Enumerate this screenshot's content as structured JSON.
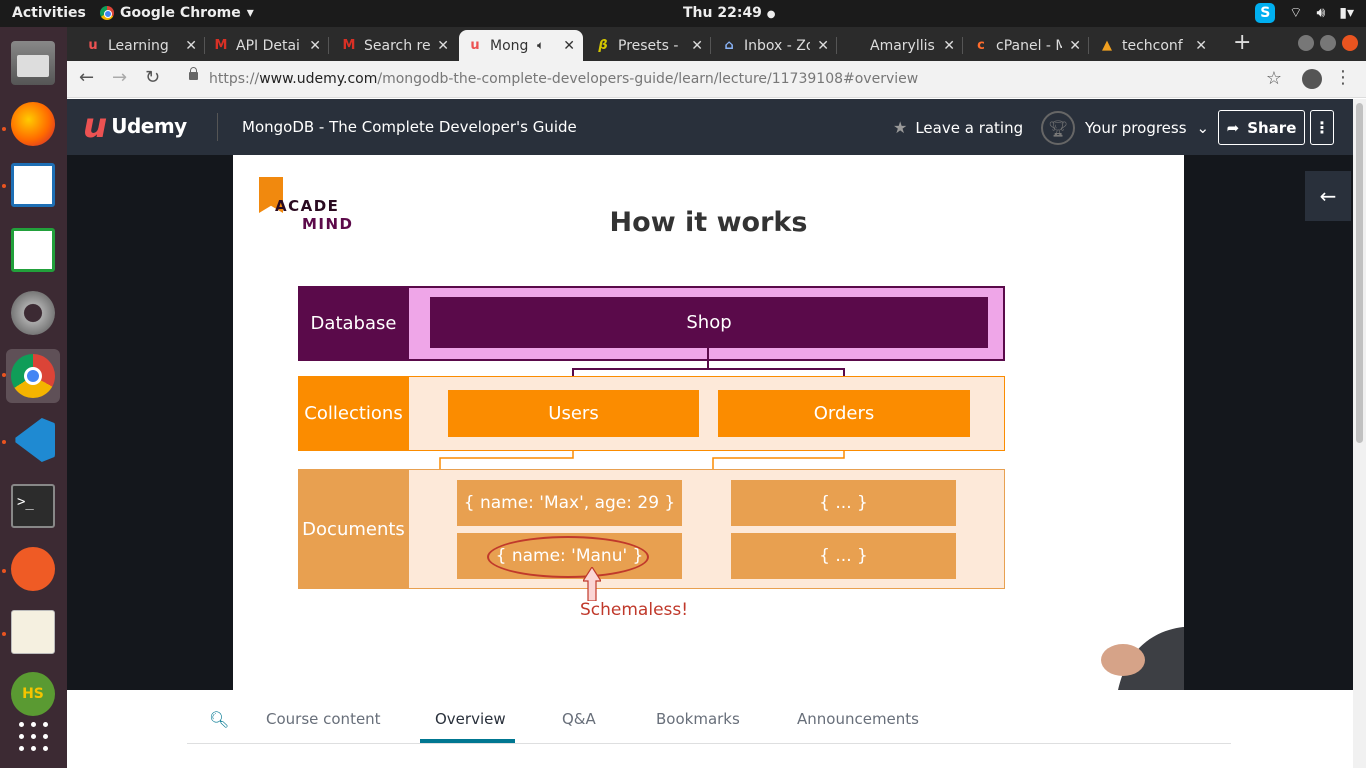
{
  "system_bar": {
    "activities": "Activities",
    "app_name": "Google Chrome",
    "clock": "Thu 22:49"
  },
  "dock": {
    "items": [
      "files-icon",
      "firefox-icon",
      "writer-icon",
      "calc-icon",
      "settings-icon",
      "chrome-icon",
      "vscode-icon",
      "terminal-icon",
      "postman-icon",
      "text-editor-icon",
      "hs-icon",
      "apps-grid-icon"
    ]
  },
  "tabs": [
    {
      "label": "Learning",
      "icon": "udemy-icon"
    },
    {
      "label": "API Detai",
      "icon": "gmail-icon"
    },
    {
      "label": "Search re",
      "icon": "gmail-icon"
    },
    {
      "label": "Mong",
      "icon": "udemy-icon",
      "active": true
    },
    {
      "label": "Presets -",
      "icon": "presets-icon"
    },
    {
      "label": "Inbox - Zo",
      "icon": "inbox-icon"
    },
    {
      "label": "Amaryllis",
      "icon": "blank-icon"
    },
    {
      "label": "cPanel - M",
      "icon": "cpanel-icon"
    },
    {
      "label": "techconf",
      "icon": "techconf-icon"
    }
  ],
  "toolbar": {
    "url_scheme": "https://",
    "url_domain": "www.udemy.com",
    "url_path": "/mongodb-the-complete-developers-guide/learn/lecture/11739108#overview"
  },
  "udemy": {
    "brand": "Udemy",
    "course_title": "MongoDB - The Complete Developer's Guide",
    "leave_rating": "Leave a rating",
    "your_progress": "Your progress",
    "share": "Share"
  },
  "slide": {
    "logo_line1": "ACADE",
    "logo_line2": "MIND",
    "title": "How it works",
    "rows": {
      "database": "Database",
      "collections": "Collections",
      "documents": "Documents"
    },
    "shop": "Shop",
    "users": "Users",
    "orders": "Orders",
    "doc1": "{ name: 'Max', age: 29 }",
    "doc2": "{ name: 'Manu' }",
    "doc3": "{ ... }",
    "doc4": "{ ... }",
    "schemaless": "Schemaless!",
    "colors": {
      "database_label": "#5a0a4a",
      "database_bg": "#efa6e8",
      "shop": "#5a0a4a",
      "collections": "#fb8c00",
      "documents_label": "#e8a050",
      "documents_bg": "#fde9d9"
    }
  },
  "bottom_tabs": [
    "Course content",
    "Overview",
    "Q&A",
    "Bookmarks",
    "Announcements"
  ],
  "active_bottom_tab": "Overview"
}
